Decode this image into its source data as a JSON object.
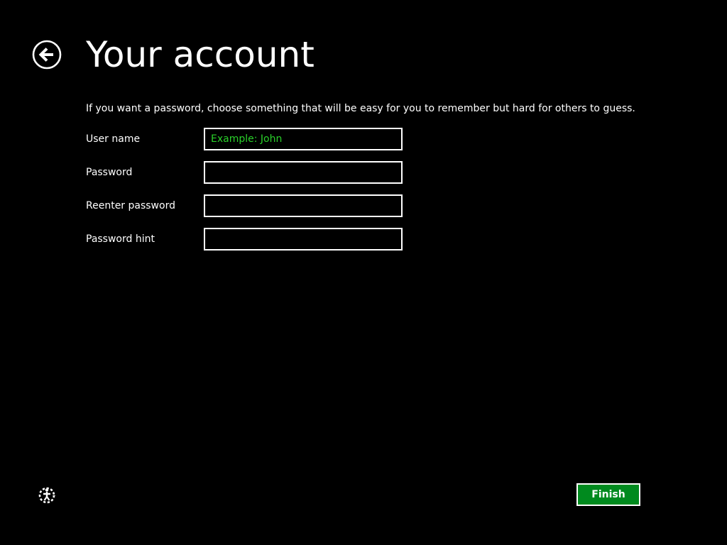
{
  "header": {
    "title": "Your account",
    "back_icon": "back-arrow-icon"
  },
  "instructions": "If you want a password, choose something that will be easy for you to remember but hard for others to guess.",
  "form": {
    "fields": [
      {
        "label": "User name",
        "value": "",
        "placeholder": "Example: John"
      },
      {
        "label": "Password",
        "value": "",
        "placeholder": ""
      },
      {
        "label": "Reenter password",
        "value": "",
        "placeholder": ""
      },
      {
        "label": "Password hint",
        "value": "",
        "placeholder": ""
      }
    ]
  },
  "footer": {
    "ease_of_access_icon": "ease-of-access-icon",
    "finish_label": "Finish"
  },
  "colors": {
    "background": "#000000",
    "text": "#ffffff",
    "accent": "#008a1e",
    "placeholder": "#2ad12a"
  }
}
